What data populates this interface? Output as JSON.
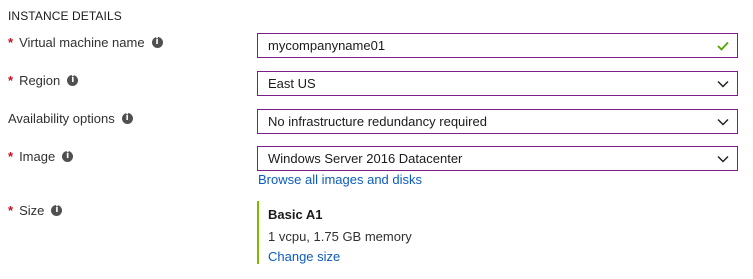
{
  "section": {
    "title": "INSTANCE DETAILS"
  },
  "fields": {
    "vm_name": {
      "required": "*",
      "label": "Virtual machine name",
      "value": "mycompanyname01",
      "status_icon": "check-icon"
    },
    "region": {
      "required": "*",
      "label": "Region",
      "value": "East US"
    },
    "availability": {
      "label": "Availability options",
      "value": "No infrastructure redundancy required"
    },
    "image": {
      "required": "*",
      "label": "Image",
      "value": "Windows Server 2016 Datacenter",
      "link": "Browse all images and disks"
    },
    "size": {
      "required": "*",
      "label": "Size",
      "name": "Basic A1",
      "description": "1 vcpu, 1.75 GB memory",
      "link": "Change size"
    }
  },
  "colors": {
    "field_border": "#7a1f85",
    "required": "#c50f1f",
    "link": "#0b5cbf",
    "check": "#57a300",
    "size_accent": "#7fba00"
  }
}
